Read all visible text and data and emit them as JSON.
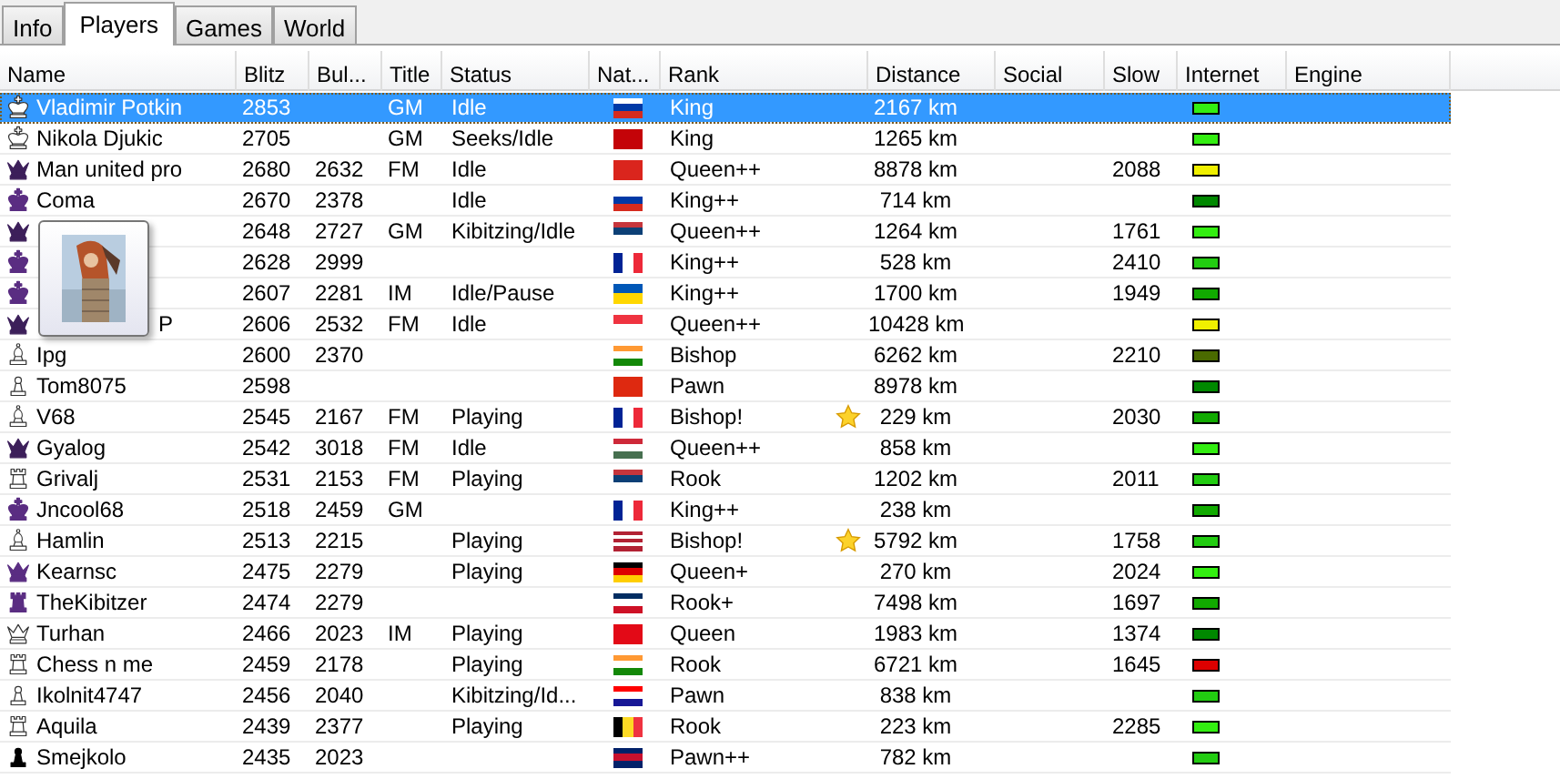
{
  "tabs": [
    {
      "label": "Info",
      "selected": false
    },
    {
      "label": "Players",
      "selected": true
    },
    {
      "label": "Games",
      "selected": false
    },
    {
      "label": "World",
      "selected": false
    }
  ],
  "columns": [
    "Name",
    "Blitz",
    "Bul...",
    "Title",
    "Status",
    "Nat...",
    "Rank",
    "Distance",
    "Social",
    "Slow",
    "Internet",
    "Engine"
  ],
  "rows": [
    {
      "piece": {
        "kind": "king",
        "filled": false
      },
      "name": "Vladimir Potkin",
      "blitz": "2853",
      "title": "GM",
      "status": "Idle",
      "flag": {
        "kind": "h",
        "stripes": [
          {
            "color": "#ffffff"
          },
          {
            "color": "#0039a6"
          },
          {
            "color": "#d52b1e"
          }
        ]
      },
      "rank": "King",
      "favorite": false,
      "distance": "2167 km",
      "internet": {
        "color": "#33ee11"
      },
      "selected": true
    },
    {
      "piece": {
        "kind": "king",
        "filled": false
      },
      "name": "Nikola Djukic",
      "blitz": "2705",
      "title": "GM",
      "status": "Seeks/Idle",
      "flag": {
        "kind": "h",
        "stripes": [
          {
            "color": "#c40308"
          }
        ]
      },
      "rank": "King",
      "favorite": false,
      "distance": "1265 km",
      "internet": {
        "color": "#33ee11"
      },
      "selected": false
    },
    {
      "piece": {
        "kind": "queen",
        "filled": true,
        "color": "#3c1f5a"
      },
      "name": "Man united pro",
      "blitz": "2680",
      "bullet": "2632",
      "title": "FM",
      "status": "Idle",
      "flag": {
        "kind": "h",
        "stripes": [
          {
            "color": "#da251d"
          }
        ]
      },
      "rank": "Queen++",
      "favorite": false,
      "distance": "8878 km",
      "slow": "2088",
      "internet": {
        "color": "#f0f000"
      },
      "selected": false
    },
    {
      "piece": {
        "kind": "king",
        "filled": true,
        "color": "#5a2d82"
      },
      "name": "Coma",
      "blitz": "2670",
      "bullet": "2378",
      "status": "Idle",
      "flag": {
        "kind": "h",
        "stripes": [
          {
            "color": "#ffffff"
          },
          {
            "color": "#0039a6"
          },
          {
            "color": "#d52b1e"
          }
        ]
      },
      "rank": "King++",
      "favorite": false,
      "distance": "714 km",
      "internet": {
        "color": "#008800"
      },
      "selected": false
    },
    {
      "piece": {
        "kind": "queen",
        "filled": true,
        "color": "#3c1f5a"
      },
      "blitz": "2648",
      "bullet": "2727",
      "title": "GM",
      "status": "Kibitzing/Idle",
      "flag": {
        "kind": "h",
        "stripes": [
          {
            "color": "#c6363c"
          },
          {
            "color": "#0c4076"
          },
          {
            "color": "#ffffff"
          }
        ]
      },
      "rank": "Queen++",
      "favorite": false,
      "distance": "1264 km",
      "slow": "1761",
      "internet": {
        "color": "#33ee11"
      },
      "selected": false
    },
    {
      "piece": {
        "kind": "king",
        "filled": true,
        "color": "#5a2d82"
      },
      "blitz": "2628",
      "bullet": "2999",
      "flag": {
        "kind": "v",
        "stripes": [
          {
            "color": "#002395"
          },
          {
            "color": "#ffffff"
          },
          {
            "color": "#ed2939"
          }
        ]
      },
      "rank": "King++",
      "favorite": false,
      "distance": "528 km",
      "slow": "2410",
      "internet": {
        "color": "#22cc11"
      },
      "selected": false
    },
    {
      "piece": {
        "kind": "king",
        "filled": true,
        "color": "#5a2d82"
      },
      "blitz": "2607",
      "bullet": "2281",
      "title": "IM",
      "status": "Idle/Pause",
      "flag": {
        "kind": "h",
        "stripes": [
          {
            "color": "#0057b7"
          },
          {
            "color": "#ffd700"
          }
        ]
      },
      "rank": "King++",
      "favorite": false,
      "distance": "1700 km",
      "slow": "1949",
      "internet": {
        "color": "#11aa00"
      },
      "selected": false
    },
    {
      "piece": {
        "kind": "queen",
        "filled": true,
        "color": "#3c1f5a"
      },
      "name": "P",
      "name_covered": true,
      "blitz": "2606",
      "bullet": "2532",
      "title": "FM",
      "status": "Idle",
      "flag": {
        "kind": "h",
        "stripes": [
          {
            "color": "#ef3340"
          },
          {
            "color": "#ffffff"
          }
        ]
      },
      "rank": "Queen++",
      "favorite": false,
      "distance": "10428 km",
      "internet": {
        "color": "#f0f000"
      },
      "selected": false
    },
    {
      "piece": {
        "kind": "bishop",
        "filled": false
      },
      "name": "Ipg",
      "blitz": "2600",
      "bullet": "2370",
      "flag": {
        "kind": "h",
        "stripes": [
          {
            "color": "#ff9933"
          },
          {
            "color": "#ffffff"
          },
          {
            "color": "#138808"
          }
        ]
      },
      "rank": "Bishop",
      "favorite": false,
      "distance": "6262 km",
      "slow": "2210",
      "internet": {
        "color": "#4a6a00"
      },
      "selected": false
    },
    {
      "piece": {
        "kind": "pawn",
        "filled": false
      },
      "name": "Tom8075",
      "blitz": "2598",
      "flag": {
        "kind": "h",
        "stripes": [
          {
            "color": "#de2910"
          }
        ]
      },
      "rank": "Pawn",
      "favorite": false,
      "distance": "8978 km",
      "internet": {
        "color": "#008800"
      },
      "selected": false
    },
    {
      "piece": {
        "kind": "bishop",
        "filled": false
      },
      "name": "V68",
      "blitz": "2545",
      "bullet": "2167",
      "title": "FM",
      "status": "Playing",
      "flag": {
        "kind": "v",
        "stripes": [
          {
            "color": "#002395"
          },
          {
            "color": "#ffffff"
          },
          {
            "color": "#ed2939"
          }
        ]
      },
      "rank": "Bishop!",
      "favorite": true,
      "distance": "229 km",
      "slow": "2030",
      "internet": {
        "color": "#11aa00"
      },
      "selected": false
    },
    {
      "piece": {
        "kind": "queen",
        "filled": true,
        "color": "#3c1f5a"
      },
      "name": "Gyalog",
      "blitz": "2542",
      "bullet": "3018",
      "title": "FM",
      "status": "Idle",
      "flag": {
        "kind": "h",
        "stripes": [
          {
            "color": "#ce2939"
          },
          {
            "color": "#ffffff"
          },
          {
            "color": "#477050"
          }
        ]
      },
      "rank": "Queen++",
      "favorite": false,
      "distance": "858 km",
      "internet": {
        "color": "#33ee11"
      },
      "selected": false
    },
    {
      "piece": {
        "kind": "rook",
        "filled": false
      },
      "name": "Grivalj",
      "blitz": "2531",
      "bullet": "2153",
      "title": "FM",
      "status": "Playing",
      "flag": {
        "kind": "h",
        "stripes": [
          {
            "color": "#c6363c"
          },
          {
            "color": "#0c4076"
          },
          {
            "color": "#ffffff"
          }
        ]
      },
      "rank": "Rook",
      "favorite": false,
      "distance": "1202 km",
      "slow": "2011",
      "internet": {
        "color": "#22cc11"
      },
      "selected": false
    },
    {
      "piece": {
        "kind": "king",
        "filled": true,
        "color": "#5a2d82"
      },
      "name": "Jncool68",
      "blitz": "2518",
      "bullet": "2459",
      "title": "GM",
      "flag": {
        "kind": "v",
        "stripes": [
          {
            "color": "#002395"
          },
          {
            "color": "#ffffff"
          },
          {
            "color": "#ed2939"
          }
        ]
      },
      "rank": "King++",
      "favorite": false,
      "distance": "238 km",
      "internet": {
        "color": "#11aa00"
      },
      "selected": false
    },
    {
      "piece": {
        "kind": "bishop",
        "filled": false
      },
      "name": "Hamlin",
      "blitz": "2513",
      "bullet": "2215",
      "status": "Playing",
      "flag": {
        "kind": "h",
        "stripes": [
          {
            "color": "#b22234"
          },
          {
            "color": "#ffffff"
          },
          {
            "color": "#b22234"
          },
          {
            "color": "#ffffff"
          },
          {
            "color": "#b22234"
          }
        ]
      },
      "rank": "Bishop!",
      "favorite": true,
      "distance": "5792 km",
      "slow": "1758",
      "internet": {
        "color": "#22cc11"
      },
      "selected": false
    },
    {
      "piece": {
        "kind": "queen",
        "filled": true,
        "color": "#5a2d82"
      },
      "name": "Kearnsc",
      "blitz": "2475",
      "bullet": "2279",
      "status": "Playing",
      "flag": {
        "kind": "h",
        "stripes": [
          {
            "color": "#000000"
          },
          {
            "color": "#dd0000"
          },
          {
            "color": "#ffce00"
          }
        ]
      },
      "rank": "Queen+",
      "favorite": false,
      "distance": "270 km",
      "slow": "2024",
      "internet": {
        "color": "#33ee11"
      },
      "selected": false
    },
    {
      "piece": {
        "kind": "rook",
        "filled": true,
        "color": "#5a2d82"
      },
      "name": "TheKibitzer",
      "blitz": "2474",
      "bullet": "2279",
      "flag": {
        "kind": "h",
        "stripes": [
          {
            "color": "#002d62"
          },
          {
            "color": "#ffffff"
          },
          {
            "color": "#ce1126"
          }
        ]
      },
      "rank": "Rook+",
      "favorite": false,
      "distance": "7498 km",
      "slow": "1697",
      "internet": {
        "color": "#11aa00"
      },
      "selected": false
    },
    {
      "piece": {
        "kind": "queen",
        "filled": false
      },
      "name": "Turhan",
      "blitz": "2466",
      "bullet": "2023",
      "title": "IM",
      "status": "Playing",
      "flag": {
        "kind": "h",
        "stripes": [
          {
            "color": "#e30a17"
          }
        ]
      },
      "rank": "Queen",
      "favorite": false,
      "distance": "1983 km",
      "slow": "1374",
      "internet": {
        "color": "#008800"
      },
      "selected": false
    },
    {
      "piece": {
        "kind": "rook",
        "filled": false
      },
      "name": "Chess n me",
      "blitz": "2459",
      "bullet": "2178",
      "status": "Playing",
      "flag": {
        "kind": "h",
        "stripes": [
          {
            "color": "#ff9933"
          },
          {
            "color": "#ffffff"
          },
          {
            "color": "#138808"
          }
        ]
      },
      "rank": "Rook",
      "favorite": false,
      "distance": "6721 km",
      "slow": "1645",
      "internet": {
        "color": "#dd0000"
      },
      "selected": false
    },
    {
      "piece": {
        "kind": "pawn",
        "filled": false
      },
      "name": "Ikolnit4747",
      "blitz": "2456",
      "bullet": "2040",
      "status": "Kibitzing/Id...",
      "flag": {
        "kind": "h",
        "stripes": [
          {
            "color": "#ff0000"
          },
          {
            "color": "#ffffff"
          },
          {
            "color": "#171796"
          }
        ]
      },
      "rank": "Pawn",
      "favorite": false,
      "distance": "838 km",
      "internet": {
        "color": "#22cc11"
      },
      "selected": false
    },
    {
      "piece": {
        "kind": "rook",
        "filled": false
      },
      "name": "Aquila",
      "blitz": "2439",
      "bullet": "2377",
      "status": "Playing",
      "flag": {
        "kind": "v",
        "stripes": [
          {
            "color": "#000000"
          },
          {
            "color": "#fdda24"
          },
          {
            "color": "#ef3340"
          }
        ]
      },
      "rank": "Rook",
      "favorite": false,
      "distance": "223 km",
      "slow": "2285",
      "internet": {
        "color": "#33ee11"
      },
      "selected": false
    },
    {
      "piece": {
        "kind": "pawn",
        "filled": true,
        "color": "#000000"
      },
      "name": "Smejkolo",
      "blitz": "2435",
      "bullet": "2023",
      "flag": {
        "kind": "h",
        "stripes": [
          {
            "color": "#012169"
          },
          {
            "color": "#c8102e"
          },
          {
            "color": "#012169"
          }
        ]
      },
      "rank": "Pawn++",
      "favorite": false,
      "distance": "782 km",
      "internet": {
        "color": "#22cc11"
      },
      "selected": false
    }
  ]
}
